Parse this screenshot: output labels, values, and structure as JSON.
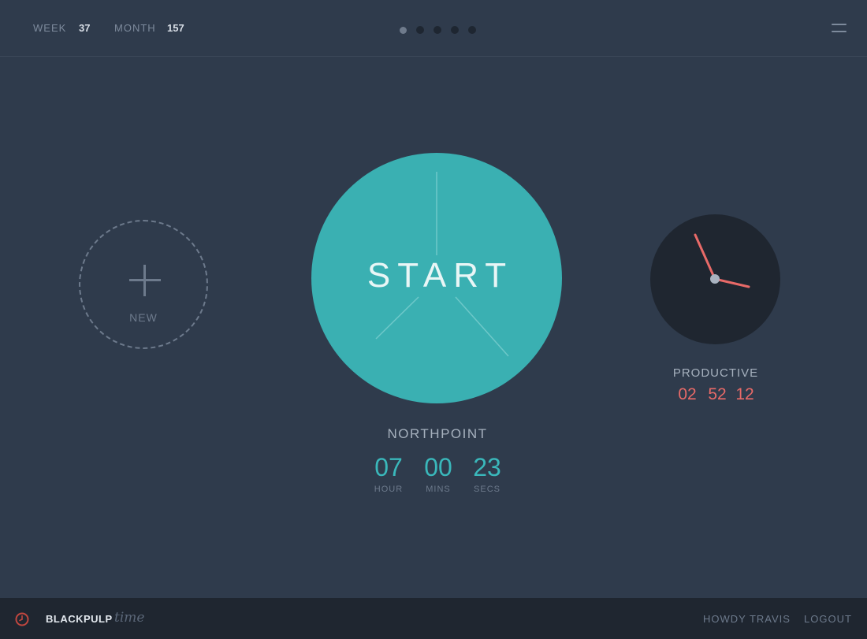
{
  "header": {
    "stats": [
      {
        "label": "WEEK",
        "value": "37"
      },
      {
        "label": "MONTH",
        "value": "157"
      }
    ],
    "pager": {
      "count": 5,
      "active": 1
    },
    "menu_icon": "hamburger-icon"
  },
  "new_project": {
    "label": "NEW",
    "icon": "plus-icon"
  },
  "timer": {
    "start_label": "START",
    "project": "NORTHPOINT",
    "hours": "07",
    "minutes": "00",
    "seconds": "23",
    "hours_unit": "HOUR",
    "minutes_unit": "MINS",
    "seconds_unit": "SECS",
    "accent": "#3ab0b2"
  },
  "productive": {
    "label": "PRODUCTIVE",
    "hours": "02",
    "minutes": "52",
    "seconds": "12",
    "accent": "#e86a68",
    "clock_icon": "clock-icon"
  },
  "footer": {
    "brand": "BLACKPULP",
    "brand_sub": "time",
    "greeting": "HOWDY TRAVIS",
    "logout": "LOGOUT",
    "logo_icon": "clock-logo-icon"
  }
}
